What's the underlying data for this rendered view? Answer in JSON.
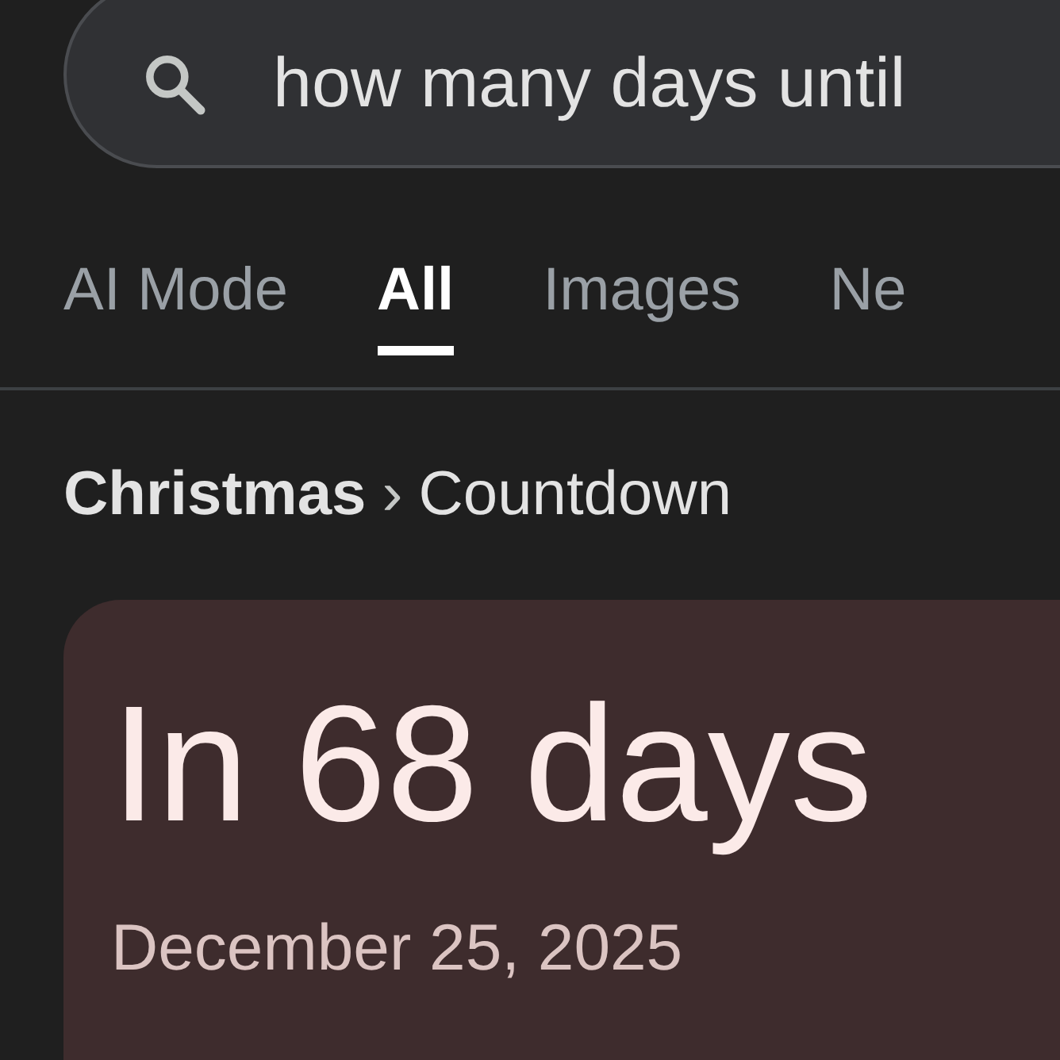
{
  "search": {
    "value": "how many days until"
  },
  "tabs": [
    {
      "label": "AI Mode",
      "selected": false
    },
    {
      "label": "All",
      "selected": true
    },
    {
      "label": "Images",
      "selected": false
    },
    {
      "label": "Ne",
      "selected": false
    }
  ],
  "breadcrumb": {
    "items": [
      "Christmas",
      "Countdown"
    ],
    "separator": "›"
  },
  "card": {
    "headline": "In 68 days",
    "date": "December 25, 2025"
  }
}
